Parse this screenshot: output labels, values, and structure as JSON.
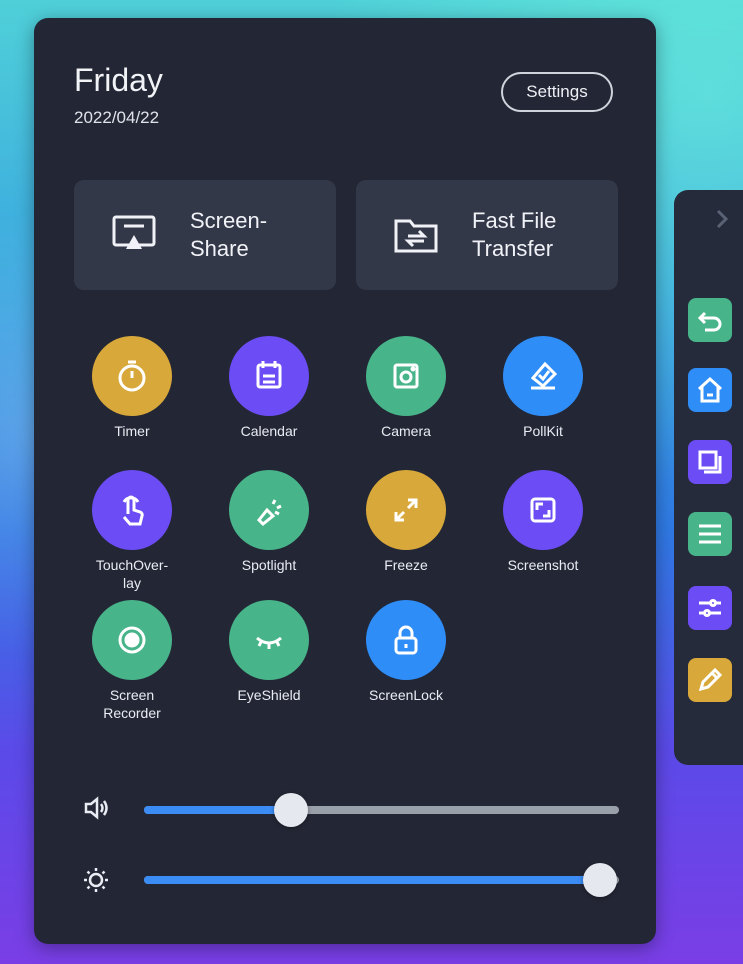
{
  "header": {
    "day": "Friday",
    "date": "2022/04/22",
    "settings_label": "Settings"
  },
  "cards": {
    "screen_share_label": "Screen-\nShare",
    "fast_file_label": "Fast File\nTransfer"
  },
  "apps": [
    {
      "label": "Timer",
      "color": "#d8a93a",
      "icon": "timer-icon"
    },
    {
      "label": "Calendar",
      "color": "#6c4cf4",
      "icon": "calendar-icon"
    },
    {
      "label": "Camera",
      "color": "#48b48a",
      "icon": "camera-icon"
    },
    {
      "label": "PollKit",
      "color": "#2f8df7",
      "icon": "pollkit-icon"
    },
    {
      "label": "TouchOver-\nlay",
      "color": "#6c4cf4",
      "icon": "touch-icon"
    },
    {
      "label": "Spotlight",
      "color": "#48b48a",
      "icon": "spotlight-icon"
    },
    {
      "label": "Freeze",
      "color": "#d8a93a",
      "icon": "freeze-icon"
    },
    {
      "label": "Screenshot",
      "color": "#6c4cf4",
      "icon": "screenshot-icon"
    },
    {
      "label": "Screen\nRecorder",
      "color": "#48b48a",
      "icon": "recorder-icon"
    },
    {
      "label": "EyeShield",
      "color": "#48b48a",
      "icon": "eyeshield-icon"
    },
    {
      "label": "ScreenLock",
      "color": "#2f8df7",
      "icon": "lock-icon"
    }
  ],
  "sliders": {
    "volume_fraction": 0.31,
    "brightness_fraction": 0.96
  },
  "side_rail": {
    "buttons": [
      {
        "icon": "back-icon",
        "color": "#48b48a"
      },
      {
        "icon": "home-icon",
        "color": "#2f8df7"
      },
      {
        "icon": "windows-icon",
        "color": "#6c4cf4"
      },
      {
        "icon": "menu-icon",
        "color": "#48b48a"
      },
      {
        "icon": "adjust-icon",
        "color": "#6c4cf4"
      },
      {
        "icon": "pen-icon",
        "color": "#d8a93a"
      }
    ]
  }
}
